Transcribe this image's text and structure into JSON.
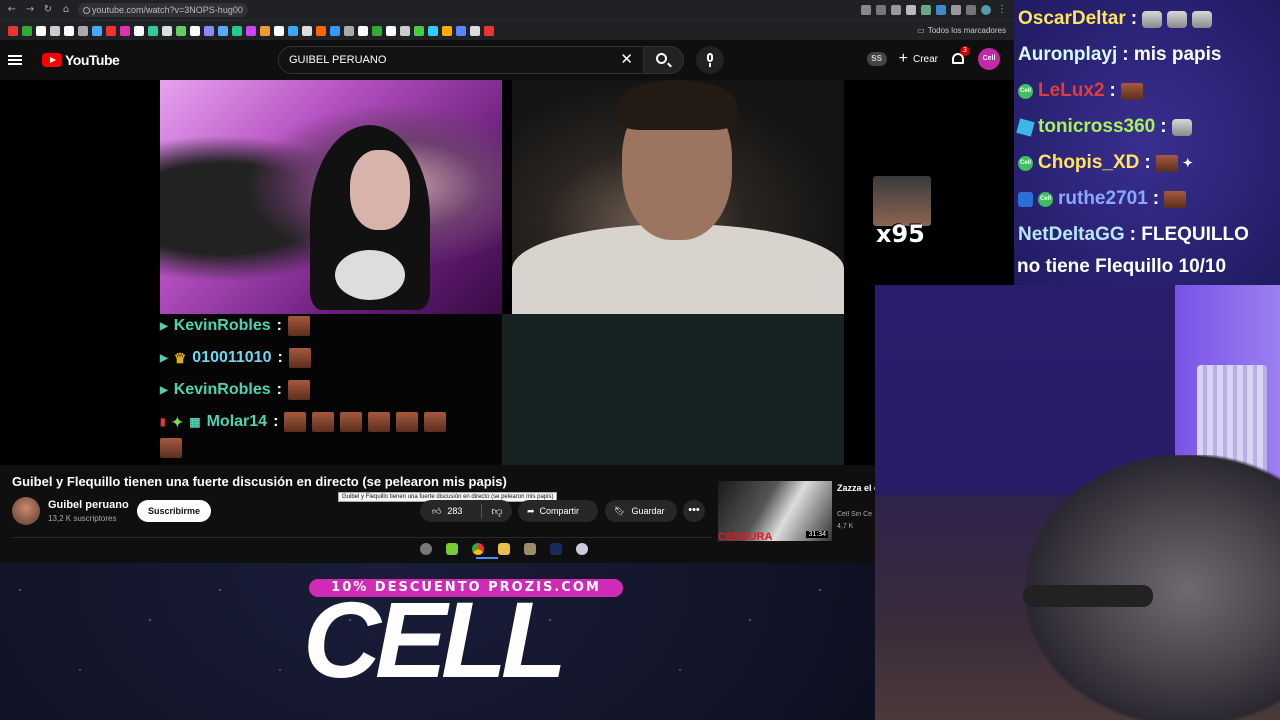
{
  "browser": {
    "url": "youtube.com/watch?v=3NOPS-hug00",
    "all_bookmarks": "Todos los marcadores"
  },
  "yt": {
    "logo_text": "YouTube",
    "search_value": "GUIBEL PERUANO",
    "ss_badge": "SS",
    "create_label": "Crear",
    "notification_count": "3",
    "avatar_text": "Cell"
  },
  "video": {
    "overlay_chat": [
      {
        "user": "KevinRobles",
        "sep": ":"
      },
      {
        "user": "010011010",
        "sep": ":"
      },
      {
        "user": "KevinRobles",
        "sep": ":"
      },
      {
        "user": "Molar14",
        "sep": ":"
      }
    ],
    "emote_count": "x95"
  },
  "info": {
    "title": "Guibel y Flequillo tienen una fuerte discusión en directo (se pelearon mis papis)",
    "tooltip": "Guibel y Flequillo tienen una fuerte discusión en directo (se pelearon mis papis)",
    "channel_name": "Guibel peruano",
    "subscribers": "13,2 K suscriptores",
    "subscribe_label": "Suscribirme",
    "likes": "283",
    "share_label": "Compartir",
    "save_label": "Guardar"
  },
  "recommended": {
    "title": "Zazza el censurar",
    "channel": "Cell Sin Ce",
    "views": "4,7 K",
    "thumb_text": "CENSURA",
    "duration": "31:34"
  },
  "twitch_chat": [
    {
      "user": "OscarDeltar",
      "msg": ":",
      "color": "#ffe45c"
    },
    {
      "user": "Auronplayj",
      "msg": ": mis papis",
      "color": "#d8fbff"
    },
    {
      "user": "LeLux2",
      "msg": ":",
      "color": "#e23b3b"
    },
    {
      "user": "tonicross360",
      "msg": ":",
      "color": "#a8f25a"
    },
    {
      "user": "Chopis_XD",
      "msg": ":",
      "color": "#ffe45c"
    },
    {
      "user": "ruthe2701",
      "msg": ":",
      "color": "#8aa8ff"
    },
    {
      "user": "NetDeltaGG",
      "msg": ": FLEQUILLO",
      "color": "#b8e6ff"
    }
  ],
  "twitch_chat_wrap": "no tiene Flequillo 10/10",
  "promo": {
    "band": "10% DESCUENTO PROZIS.COM",
    "brand": "CELL"
  }
}
